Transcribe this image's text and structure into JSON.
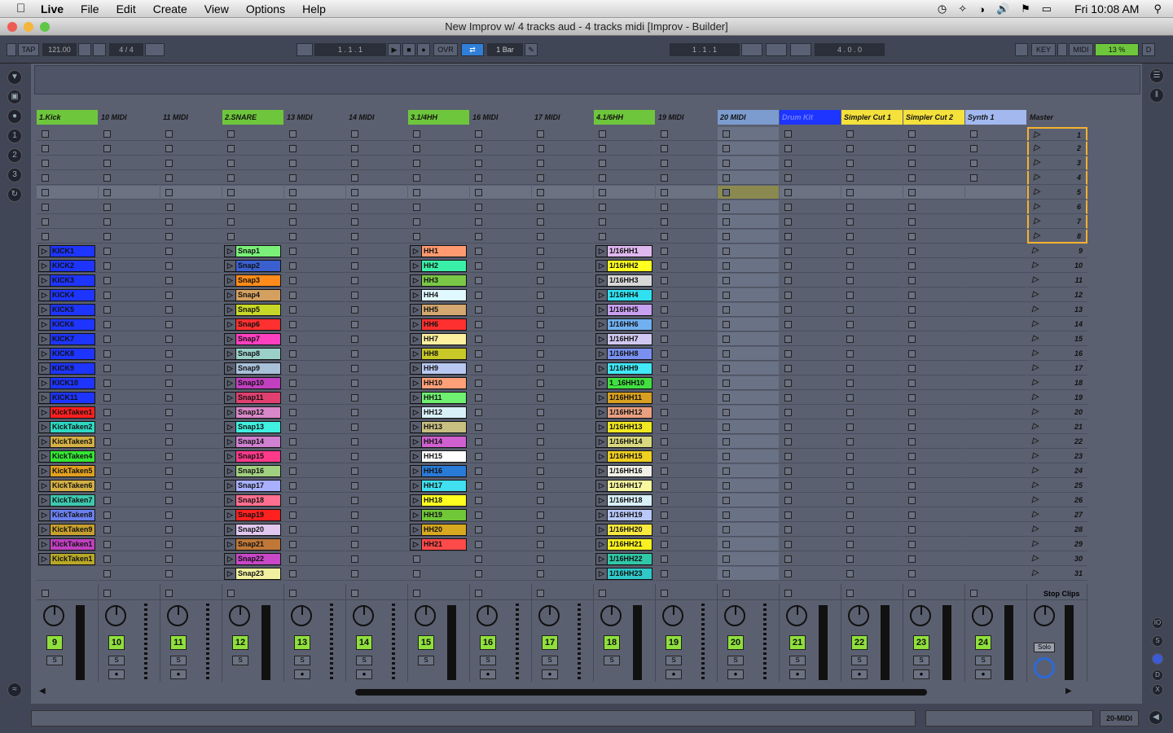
{
  "menubar": {
    "app": "Live",
    "items": [
      "File",
      "Edit",
      "Create",
      "View",
      "Options",
      "Help"
    ],
    "clock": "Fri 10:08 AM"
  },
  "window": {
    "title": "New Improv w/ 4 tracks aud - 4 tracks midi  [Improv - Builder]"
  },
  "toolbar": {
    "tap": "TAP",
    "tempo": "121.00",
    "signature": "4 / 4",
    "position": "1 .   1 .   1",
    "ovr": "OVR",
    "quant": "1 Bar",
    "loop_start": "1 .   1 .   1",
    "loop_len": "4 .   0 .   0",
    "key": "KEY",
    "midi": "MIDI",
    "cpu": "13 %",
    "d": "D"
  },
  "tracks": [
    {
      "name": "1.Kick",
      "color": "#6ec63c",
      "num": "9"
    },
    {
      "name": "10 MIDI",
      "color": "#5b6070",
      "num": "10"
    },
    {
      "name": "11 MIDI",
      "color": "#5b6070",
      "num": "11"
    },
    {
      "name": "2.SNARE",
      "color": "#6ec63c",
      "num": "12"
    },
    {
      "name": "13 MIDI",
      "color": "#5b6070",
      "num": "13"
    },
    {
      "name": "14 MIDI",
      "color": "#5b6070",
      "num": "14"
    },
    {
      "name": "3.1/4HH",
      "color": "#6ec63c",
      "num": "15"
    },
    {
      "name": "16 MIDI",
      "color": "#5b6070",
      "num": "16"
    },
    {
      "name": "17 MIDI",
      "color": "#5b6070",
      "num": "17"
    },
    {
      "name": "4.1/6HH",
      "color": "#6ec63c",
      "num": "18"
    },
    {
      "name": "19 MIDI",
      "color": "#5b6070",
      "num": "19"
    },
    {
      "name": "20 MIDI",
      "color": "#7c9ccf",
      "num": "20"
    },
    {
      "name": "Drum Kit",
      "color": "#1e35ff",
      "num": "21"
    },
    {
      "name": "Simpler Cut 1",
      "color": "#f4e13c",
      "num": "22"
    },
    {
      "name": "Simpler Cut 2",
      "color": "#f4e13c",
      "num": "23"
    },
    {
      "name": "Synth 1",
      "color": "#a2b8ef",
      "num": "24"
    }
  ],
  "master": {
    "name": "Master",
    "stop_clips": "Stop Clips",
    "solo": "Solo",
    "scenes": [
      "1",
      "2",
      "3",
      "4",
      "5",
      "6",
      "7",
      "8",
      "9",
      "10",
      "11",
      "12",
      "13",
      "14",
      "15",
      "16",
      "17",
      "18",
      "19",
      "20",
      "21",
      "22",
      "23",
      "24",
      "25",
      "26",
      "27",
      "28",
      "29",
      "30",
      "31"
    ]
  },
  "clips": {
    "kick": [
      {
        "n": "KICK1",
        "c": "#1e35ff"
      },
      {
        "n": "KICK2",
        "c": "#1e35ff"
      },
      {
        "n": "KICK3",
        "c": "#1e35ff"
      },
      {
        "n": "KICK4",
        "c": "#1e35ff"
      },
      {
        "n": "KICK5",
        "c": "#1e35ff"
      },
      {
        "n": "KICK6",
        "c": "#1e35ff"
      },
      {
        "n": "KICK7",
        "c": "#1e35ff"
      },
      {
        "n": "KICK8",
        "c": "#1e35ff"
      },
      {
        "n": "KICK9",
        "c": "#1e35ff"
      },
      {
        "n": "KICK10",
        "c": "#1e35ff"
      },
      {
        "n": "KICK11",
        "c": "#1e35ff"
      },
      {
        "n": "KickTaken1",
        "c": "#ff2020"
      },
      {
        "n": "KickTaken2",
        "c": "#2ed9c2"
      },
      {
        "n": "KickTaken3",
        "c": "#d4b046"
      },
      {
        "n": "KickTaken4",
        "c": "#35e635"
      },
      {
        "n": "KickTaken5",
        "c": "#e0a020"
      },
      {
        "n": "KickTaken6",
        "c": "#d4b046"
      },
      {
        "n": "KickTaken7",
        "c": "#3ec9b0"
      },
      {
        "n": "KickTaken8",
        "c": "#6a80f0"
      },
      {
        "n": "KickTaken9",
        "c": "#c8a030"
      },
      {
        "n": "KickTaken1",
        "c": "#c040c0"
      },
      {
        "n": "KickTaken1",
        "c": "#b8a828"
      }
    ],
    "snare": [
      {
        "n": "Snap1",
        "c": "#7af07a"
      },
      {
        "n": "Snap2",
        "c": "#3a60d0"
      },
      {
        "n": "Snap3",
        "c": "#ff8c1a"
      },
      {
        "n": "Snap4",
        "c": "#d4a060"
      },
      {
        "n": "Snap5",
        "c": "#c8d828"
      },
      {
        "n": "Snap6",
        "c": "#ff3030"
      },
      {
        "n": "Snap7",
        "c": "#ff40c0"
      },
      {
        "n": "Snap8",
        "c": "#9ad0c8"
      },
      {
        "n": "Snap9",
        "c": "#a8c0d8"
      },
      {
        "n": "Snap10",
        "c": "#c040c0"
      },
      {
        "n": "Snap11",
        "c": "#e04070"
      },
      {
        "n": "Snap12",
        "c": "#d888c8"
      },
      {
        "n": "Snap13",
        "c": "#40f0e0"
      },
      {
        "n": "Snap14",
        "c": "#d080d0"
      },
      {
        "n": "Snap15",
        "c": "#ff3a8a"
      },
      {
        "n": "Snap16",
        "c": "#a0d080"
      },
      {
        "n": "Snap17",
        "c": "#a8b0ff"
      },
      {
        "n": "Snap18",
        "c": "#ff7090"
      },
      {
        "n": "Snap19",
        "c": "#ff2020"
      },
      {
        "n": "Snap20",
        "c": "#e0c8f0"
      },
      {
        "n": "Snap21",
        "c": "#c07838"
      },
      {
        "n": "Snap22",
        "c": "#c848c8"
      },
      {
        "n": "Snap23",
        "c": "#f0f0a0"
      }
    ],
    "hh": [
      {
        "n": "HH1",
        "c": "#ff9a70"
      },
      {
        "n": "HH2",
        "c": "#3af0a8"
      },
      {
        "n": "HH3",
        "c": "#7ac848"
      },
      {
        "n": "HH4",
        "c": "#e0f8ff"
      },
      {
        "n": "HH5",
        "c": "#d4a870"
      },
      {
        "n": "HH6",
        "c": "#ff3030"
      },
      {
        "n": "HH7",
        "c": "#fff0a0"
      },
      {
        "n": "HH8",
        "c": "#c8c828"
      },
      {
        "n": "HH9",
        "c": "#b8c8f0"
      },
      {
        "n": "HH10",
        "c": "#ffa078"
      },
      {
        "n": "HH11",
        "c": "#70f070"
      },
      {
        "n": "HH12",
        "c": "#d8f0f8"
      },
      {
        "n": "HH13",
        "c": "#c8c080"
      },
      {
        "n": "HH14",
        "c": "#d060d0"
      },
      {
        "n": "HH15",
        "c": "#ffffff"
      },
      {
        "n": "HH16",
        "c": "#2a7ad8"
      },
      {
        "n": "HH17",
        "c": "#40e0f0"
      },
      {
        "n": "HH18",
        "c": "#ffff20"
      },
      {
        "n": "HH19",
        "c": "#70c838"
      },
      {
        "n": "HH20",
        "c": "#d8a820"
      },
      {
        "n": "HH21",
        "c": "#ff4a4a"
      }
    ],
    "hh16": [
      {
        "n": "1/16HH1",
        "c": "#e0b8f0"
      },
      {
        "n": "1/16HH2",
        "c": "#ffff20"
      },
      {
        "n": "1/16HH3",
        "c": "#d8d8d8"
      },
      {
        "n": "1/16HH4",
        "c": "#30e0f0"
      },
      {
        "n": "1/16HH5",
        "c": "#c8a0f0"
      },
      {
        "n": "1/16HH6",
        "c": "#70b0f0"
      },
      {
        "n": "1/16HH7",
        "c": "#d0c8f0"
      },
      {
        "n": "1/16HH8",
        "c": "#7a90f0"
      },
      {
        "n": "1/16HH9",
        "c": "#40e8f8"
      },
      {
        "n": "1_16HH10",
        "c": "#40e040"
      },
      {
        "n": "1/16HH11",
        "c": "#d8a020"
      },
      {
        "n": "1/16HH12",
        "c": "#e8a080"
      },
      {
        "n": "1/16HH13",
        "c": "#f0e820"
      },
      {
        "n": "1/16HH14",
        "c": "#d8d880"
      },
      {
        "n": "1/16HH15",
        "c": "#f0d020"
      },
      {
        "n": "1/16HH16",
        "c": "#f0f0e8"
      },
      {
        "n": "1/16HH17",
        "c": "#f8f8a0"
      },
      {
        "n": "1/16HH18",
        "c": "#d8f0f8"
      },
      {
        "n": "1/16HH19",
        "c": "#b8c8f8"
      },
      {
        "n": "1/16HH20",
        "c": "#f8e840"
      },
      {
        "n": "1/16HH21",
        "c": "#f8f020"
      },
      {
        "n": "1/16HH22",
        "c": "#30c8a8"
      },
      {
        "n": "1/16HH23",
        "c": "#30c8c8"
      }
    ]
  },
  "status": {
    "track": "20-MIDI"
  },
  "colors": {
    "accent": "#6ec63c",
    "session_bg": "#5b6070",
    "scene_highlight": "#f5b22e"
  }
}
